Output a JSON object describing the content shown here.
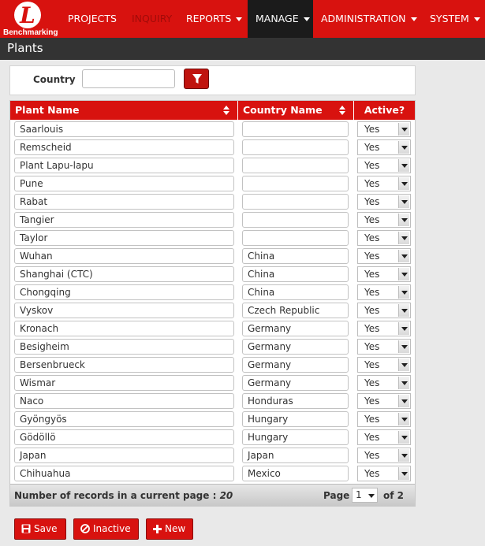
{
  "nav": {
    "logo_text": "Benchmarking",
    "items": [
      {
        "label": "PROJECTS",
        "has_caret": false
      },
      {
        "label": "INQUIRY",
        "has_caret": false
      },
      {
        "label": "REPORTS",
        "has_caret": true
      },
      {
        "label": "MANAGE",
        "has_caret": true
      },
      {
        "label": "ADMINISTRATION",
        "has_caret": true
      },
      {
        "label": "SYSTEM",
        "has_caret": true
      }
    ]
  },
  "page": {
    "title": "Plants"
  },
  "filter": {
    "label": "Country",
    "value": ""
  },
  "grid": {
    "columns": [
      "Plant Name",
      "Country Name",
      "Active?"
    ],
    "rows": [
      {
        "plant": "Saarlouis",
        "country": "",
        "active": "Yes"
      },
      {
        "plant": "Remscheid",
        "country": "",
        "active": "Yes"
      },
      {
        "plant": "Plant Lapu-lapu",
        "country": "",
        "active": "Yes"
      },
      {
        "plant": "Pune",
        "country": "",
        "active": "Yes"
      },
      {
        "plant": "Rabat",
        "country": "",
        "active": "Yes"
      },
      {
        "plant": "Tangier",
        "country": "",
        "active": "Yes"
      },
      {
        "plant": "Taylor",
        "country": "",
        "active": "Yes"
      },
      {
        "plant": "Wuhan",
        "country": "China",
        "active": "Yes"
      },
      {
        "plant": "Shanghai (CTC)",
        "country": "China",
        "active": "Yes"
      },
      {
        "plant": "Chongqing",
        "country": "China",
        "active": "Yes"
      },
      {
        "plant": "Vyskov",
        "country": "Czech Republic",
        "active": "Yes"
      },
      {
        "plant": "Kronach",
        "country": "Germany",
        "active": "Yes"
      },
      {
        "plant": "Besigheim",
        "country": "Germany",
        "active": "Yes"
      },
      {
        "plant": "Bersenbrueck",
        "country": "Germany",
        "active": "Yes"
      },
      {
        "plant": "Wismar",
        "country": "Germany",
        "active": "Yes"
      },
      {
        "plant": "Naco",
        "country": "Honduras",
        "active": "Yes"
      },
      {
        "plant": "Gyöngyös",
        "country": "Hungary",
        "active": "Yes"
      },
      {
        "plant": "Gödöllö",
        "country": "Hungary",
        "active": "Yes"
      },
      {
        "plant": "Japan",
        "country": "Japan",
        "active": "Yes"
      },
      {
        "plant": "Chihuahua",
        "country": "Mexico",
        "active": "Yes"
      }
    ],
    "footer": {
      "records_label": "Number of records in a current page :",
      "records_count": "20",
      "page_label": "Page",
      "page_value": "1",
      "page_of": "of 2"
    }
  },
  "buttons": {
    "save": "Save",
    "inactive": "Inactive",
    "new": "New"
  },
  "colors": {
    "brand_red": "#d8120f",
    "dark_bar": "#333333",
    "active_nav": "#1b1b1b"
  }
}
